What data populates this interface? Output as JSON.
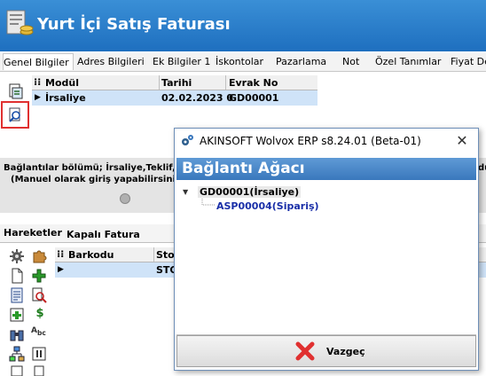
{
  "window": {
    "title": "Yurt İçi Satış Faturası",
    "icon": "invoice-coins-icon"
  },
  "tabs": [
    {
      "label": "Genel Bilgiler",
      "selected": true
    },
    {
      "label": "Adres Bilgileri"
    },
    {
      "label": "Ek Bilgiler 1"
    },
    {
      "label": "İskontolar"
    },
    {
      "label": "Pazarlama"
    },
    {
      "label": "Not"
    },
    {
      "label": "Özel Tanımlar"
    },
    {
      "label": "Fiyat De"
    }
  ],
  "upper_grid": {
    "columns": [
      "Modül",
      "Tarihi",
      "Evrak No"
    ],
    "rows": [
      {
        "modul": "İrsaliye",
        "tarihi": "02.02.2023 0",
        "evrak_no": "GD00001"
      }
    ]
  },
  "note": {
    "line1": "Bağlantılar bölümü; İrsaliye,Teklif,",
    "line2": "(Manuel olarak giriş yapabilirsini",
    "line1_right": "dü"
  },
  "lower_tabs": [
    "Hareketler",
    "Kapalı Fatura"
  ],
  "lower_grid": {
    "columns": [
      "Barkodu",
      "Sto"
    ],
    "rows": [
      {
        "barkodu": "",
        "stok": "STO"
      }
    ]
  },
  "dialog": {
    "title": "AKINSOFT Wolvox ERP s8.24.01 (Beta-01)",
    "header": "Bağlantı Ağacı",
    "tree": {
      "root": "GD00001(İrsaliye)",
      "child": "ASP00004(Sipariş)"
    },
    "cancel_label": "Vazgeç"
  },
  "colors": {
    "title_bar": "#1e6fbf",
    "dialog_header": "#3a78bd",
    "selection_row": "#cfe3f8",
    "tree_child_text": "#1a2fa8",
    "highlight_border": "#e03030",
    "cancel_icon": "#e03030"
  }
}
